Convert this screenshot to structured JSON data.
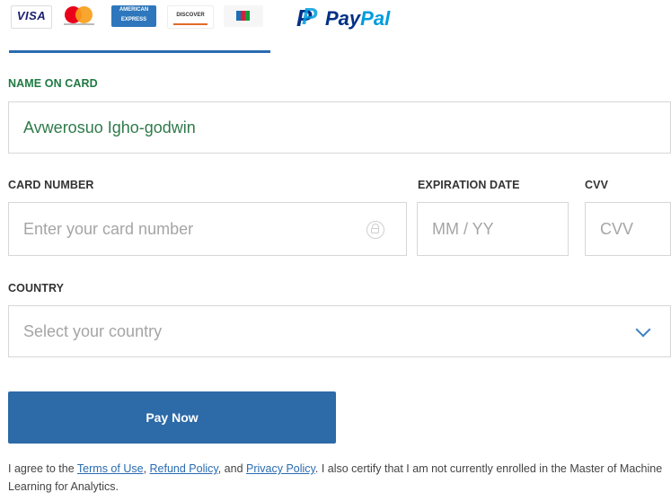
{
  "tabs": {
    "card_logos": {
      "visa": "VISA",
      "amex_line1": "AMERICAN",
      "amex_line2": "EXPRESS",
      "discover": "DISCOVER"
    },
    "paypal": {
      "pay": "Pay",
      "pal": "Pal"
    }
  },
  "form": {
    "name_label": "NAME ON CARD",
    "name_value": "Avwerosuo Igho-godwin",
    "card_number_label": "CARD NUMBER",
    "card_number_placeholder": "Enter your card number",
    "expiration_label": "EXPIRATION DATE",
    "expiration_placeholder": "MM / YY",
    "cvv_label": "CVV",
    "cvv_placeholder": "CVV",
    "country_label": "COUNTRY",
    "country_placeholder": "Select your country"
  },
  "actions": {
    "pay_now": "Pay Now"
  },
  "agreement": {
    "prefix": "I agree to the ",
    "terms": "Terms of Use",
    "sep1": ", ",
    "refund": "Refund Policy",
    "sep2": ", and ",
    "privacy": "Privacy Policy",
    "suffix": ". I also certify that I am not currently enrolled in the Master of Machine Learning for Analytics."
  },
  "colors": {
    "accent": "#2c6aa8",
    "label_green": "#1f7a43",
    "value_green": "#2f7a4a",
    "link": "#2a6bb0"
  }
}
